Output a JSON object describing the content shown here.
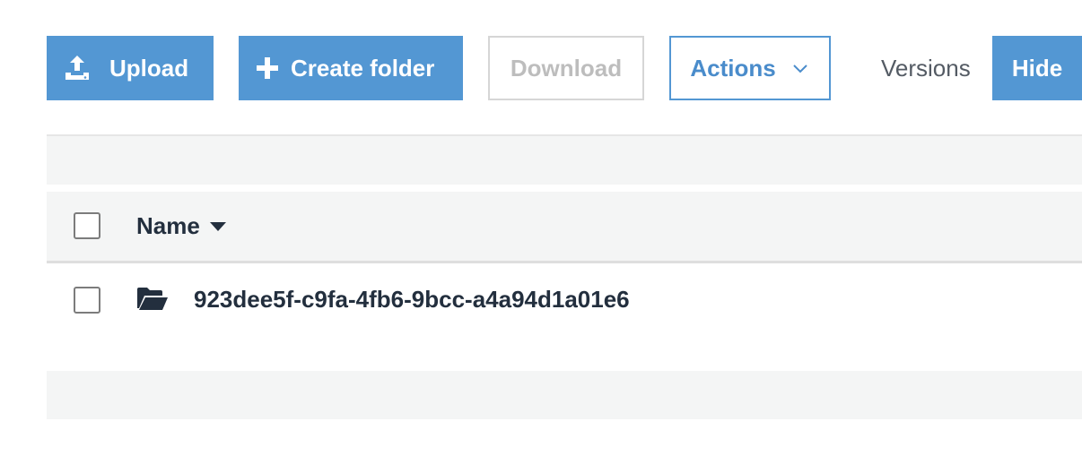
{
  "toolbar": {
    "upload_label": "Upload",
    "upload_icon": "upload-icon",
    "create_folder_label": "Create folder",
    "create_folder_icon": "plus-icon",
    "download_label": "Download",
    "actions_label": "Actions",
    "actions_icon": "chevron-down-icon",
    "versions_label": "Versions",
    "hide_label": "Hide"
  },
  "table": {
    "columns": [
      {
        "label": "Name",
        "sort_icon": "caret-down-icon",
        "sort": "descending"
      }
    ],
    "rows": [
      {
        "type": "folder",
        "icon": "folder-open-icon",
        "name": "923dee5f-c9fa-4fb6-9bcc-a4a94d1a01e6",
        "checked": false
      }
    ]
  },
  "colors": {
    "primary": "#5397d3",
    "text": "#232f3e",
    "muted": "#545b64",
    "disabled": "#bdbdbd",
    "band": "#f4f5f5"
  }
}
